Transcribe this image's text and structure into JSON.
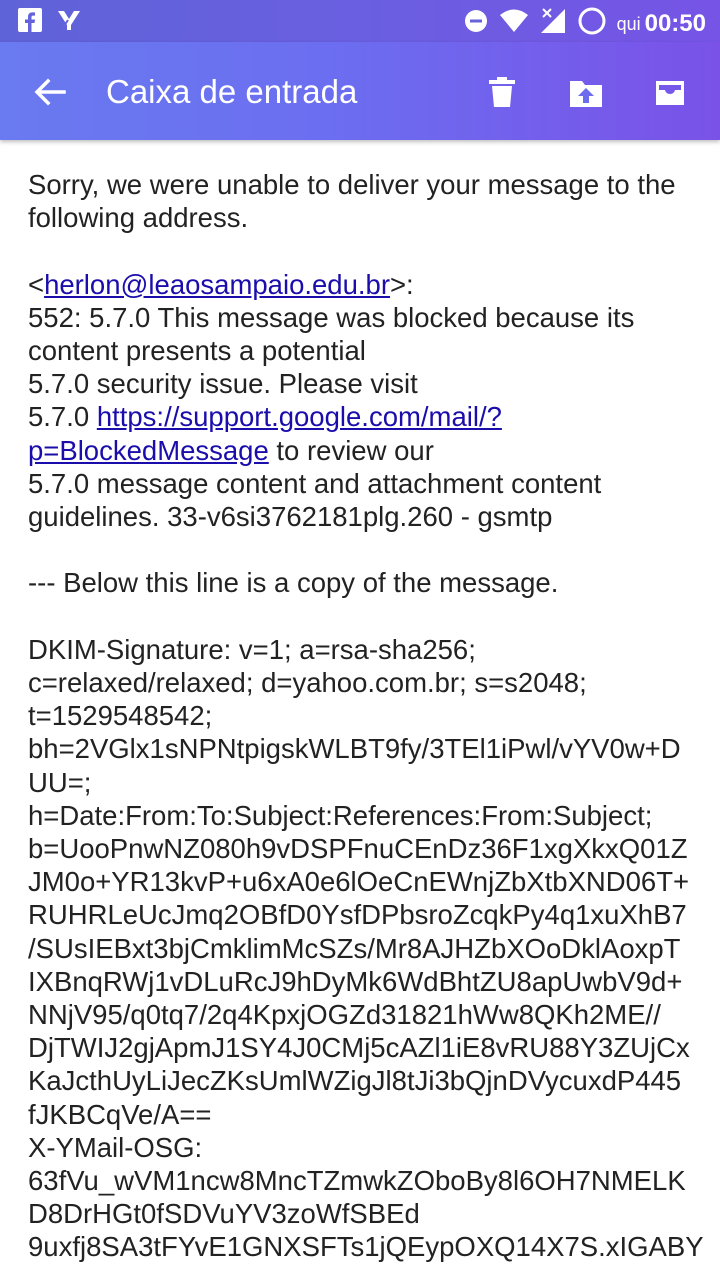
{
  "status_bar": {
    "left_icons": [
      "facebook-icon",
      "notification-app-icon"
    ],
    "right_icons": [
      "do-not-disturb-icon",
      "wifi-icon",
      "signal-icon",
      "battery-icon"
    ],
    "day": "qui",
    "time": "00:50"
  },
  "app_bar": {
    "title": "Caixa de entrada",
    "actions": [
      "delete",
      "move-to-folder",
      "archive"
    ]
  },
  "message": {
    "line1": "Sorry, we were unable to deliver your message to the following address.",
    "recipient_prefix": "<",
    "recipient": "herlon@leaosampaio.edu.br",
    "recipient_suffix": ">:",
    "error_line1": "552: 5.7.0 This message was blocked because its",
    "error_line2": "content presents a potential",
    "error_line3": "5.7.0 security issue. Please visit",
    "error_line4_prefix": "5.7.0 ",
    "error_link": "https://support.google.com/mail/?p=BlockedMessage",
    "error_line4_suffix": " to review our",
    "error_line5": "5.7.0 message content and attachment content",
    "error_line6": "guidelines. 33-v6si3762181plg.260 - gsmtp",
    "copy_line": "--- Below this line is a copy of the message.",
    "dkim": [
      "DKIM-Signature: v=1; a=rsa-sha256;",
      "c=relaxed/relaxed; d=yahoo.com.br; s=s2048;",
      "t=1529548542;",
      "bh=2VGlx1sNPNtpigskWLBT9fy/3TEl1iPwl/vYV0w+D",
      "UU=;",
      "h=Date:From:To:Subject:References:From:Subject;",
      "b=UooPnwNZ080h9vDSPFnuCEnDz36F1xgXkxQ01Z",
      "JM0o+YR13kvP+u6xA0e6lOeCnEWnjZbXtbXND06T+",
      "RUHRLeUcJmq2OBfD0YsfDPbsroZcqkPy4q1xuXhB7",
      "/SUsIEBxt3bjCmklimMcSZs/Mr8AJHZbXOoDklAoxpT",
      "IXBnqRWj1vDLuRcJ9hDyMk6WdBhtZU8apUwbV9d+",
      "NNjV95/q0tq7/2q4KpxjOGZd31821hWw8QKh2ME//",
      "DjTWIJ2gjApmJ1SY4J0CMj5cAZl1iE8vRU88Y3ZUjCx",
      "KaJcthUyLiJecZKsUmlWZigJl8tJi3bQjnDVycuxdP445",
      "fJKBCqVe/A==",
      "X-YMail-OSG:",
      "63fVu_wVM1ncw8MncTZmwkZOboBy8l6OH7NMELK",
      "D8DrHGt0fSDVuYV3zoWfSBEd",
      "9uxfj8SA3tFYvE1GNXSFTs1jQEypOXQ14X7S.xIGABY"
    ]
  }
}
